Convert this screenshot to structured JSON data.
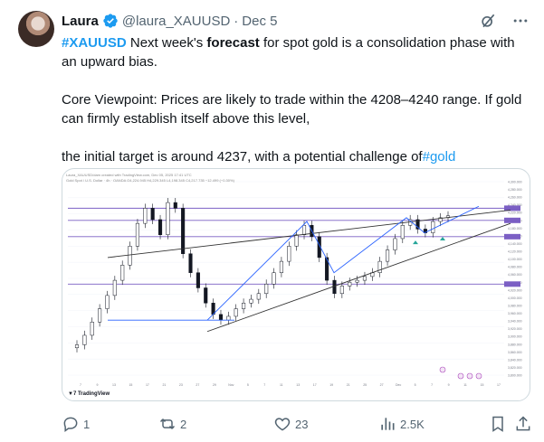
{
  "author": {
    "name": "Laura",
    "handle": "@laura_XAUUSD",
    "date": "Dec 5"
  },
  "body": {
    "line1_hashtag": "#XAUUSD",
    "line1_pre": " Next week's ",
    "line1_bold": "forecast",
    "line1_post": " for spot gold is a consolidation phase with an upward bias.",
    "line2": "Core Viewpoint: Prices are likely to trade within the 4208–4240 range. If gold can firmly establish itself above this level,",
    "line3_text": "the initial target is around 4237, with a potential challenge of",
    "line3_hashtag": "#gold"
  },
  "chart": {
    "header_line1": "Laura_XAUUSD/dam created with TradingView.com, Dec 05, 2025 17:41 UTC",
    "header_line2": "Gold Spot / U.S. Dollar · 4h · OANDA O4,224.945 H4,229.345 L4,198.345 C4,217.735 −12.499 (−0.30%)",
    "watermark": "TradingView",
    "price_labels": [
      "4,300.000",
      "4,280.000",
      "4,260.000",
      "4,240.000",
      "4,220.000",
      "4,200.000",
      "4,180.000",
      "4,160.000",
      "4,140.000",
      "4,120.000",
      "4,100.000",
      "4,080.000",
      "4,060.000",
      "4,040.000",
      "4,020.000",
      "4,000.000",
      "3,980.000",
      "3,960.000",
      "3,940.000",
      "3,920.000",
      "3,900.000",
      "3,880.000",
      "3,860.000",
      "3,840.000",
      "3,820.000",
      "3,800.000"
    ],
    "time_labels": [
      "7",
      "9",
      "13",
      "15",
      "17",
      "21",
      "23",
      "27",
      "29",
      "Nov",
      "5",
      "7",
      "11",
      "13",
      "17",
      "19",
      "21",
      "25",
      "27",
      "Dec",
      "5",
      "7",
      "9",
      "11",
      "15",
      "17"
    ]
  },
  "chart_data": {
    "type": "line",
    "title": "Gold Spot / U.S. Dollar · 4h · OANDA",
    "xlabel": "",
    "ylabel": "",
    "series": [
      {
        "values": [
          3880,
          3905,
          3940,
          3975,
          4010,
          4050,
          4090,
          4140,
          4200,
          4240,
          4210,
          4170,
          4255,
          4240,
          4120,
          4070,
          4030,
          3990,
          3960,
          3945,
          3955,
          3975,
          3990,
          4000,
          4015,
          4040,
          4070,
          4100,
          4140,
          4170,
          4195,
          4165,
          4110,
          4050,
          4015,
          4035,
          4045,
          4050,
          4060,
          4070,
          4100,
          4130,
          4160,
          4195,
          4210,
          4185,
          4175,
          4205,
          4215,
          4220
        ]
      }
    ],
    "annotations": {
      "horizontal_levels": [
        4208,
        4240,
        4165,
        4040
      ],
      "trend_lines": [
        "upper channel",
        "lower channel"
      ],
      "targets": [
        4237
      ]
    }
  },
  "actions": {
    "reply_count": "1",
    "retweet_count": "2",
    "like_count": "23",
    "views_count": "2.5K"
  },
  "colors": {
    "accent": "#1d9bf0",
    "muted": "#536471",
    "candle": "#131722",
    "level_purple": "#7b5fc4",
    "trend_blue": "#2962ff",
    "marker_teal": "#26a69a"
  }
}
